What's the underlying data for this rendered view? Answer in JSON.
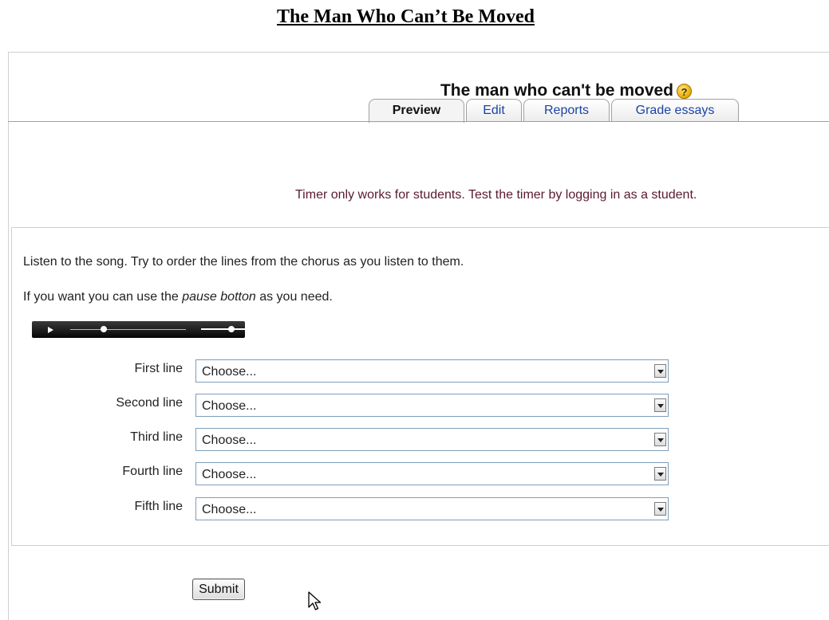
{
  "document": {
    "title": "The Man Who Can’t Be Moved"
  },
  "quiz": {
    "title": "The man who can't be moved",
    "help_icon": "help-icon",
    "tabs": [
      {
        "label": "Preview",
        "active": true
      },
      {
        "label": "Edit",
        "active": false
      },
      {
        "label": "Reports",
        "active": false
      },
      {
        "label": "Grade essays",
        "active": false
      }
    ],
    "timer_message": "Timer only works for students. Test the timer by logging in as a student."
  },
  "question": {
    "instruction_1": "Listen to the song. Try to order the lines from the chorus as you listen to them.",
    "instruction_2_prefix": "If you want you can use the ",
    "instruction_2_emphasis": "pause botton",
    "instruction_2_suffix": " as you need.",
    "rows": [
      {
        "label": "First line",
        "value": "Choose..."
      },
      {
        "label": "Second line",
        "value": "Choose..."
      },
      {
        "label": "Third line",
        "value": "Choose..."
      },
      {
        "label": "Fourth line",
        "value": "Choose..."
      },
      {
        "label": "Fifth line",
        "value": "Choose..."
      }
    ]
  },
  "actions": {
    "submit_label": "Submit"
  },
  "colors": {
    "tab_link": "#1b44a5",
    "timer_text": "#5a1a2e",
    "player_bg": "#050505"
  }
}
